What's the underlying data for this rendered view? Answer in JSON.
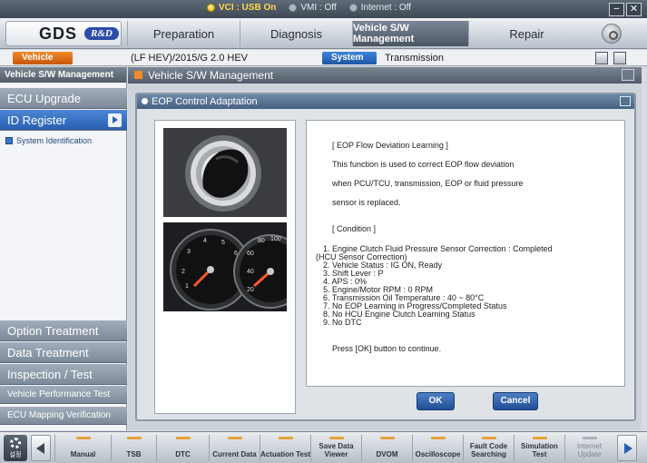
{
  "status": {
    "vci": "VCI : USB On",
    "vmi": "VMI : Off",
    "internet": "Internet : Off",
    "minimize": "−",
    "close": "✕"
  },
  "brand": {
    "logo": "GDS",
    "badge": "R&D"
  },
  "tabs": [
    {
      "label": "Preparation"
    },
    {
      "label": "Diagnosis"
    },
    {
      "label": "Vehicle S/W Management",
      "active": true
    },
    {
      "label": "Repair"
    }
  ],
  "vehicle": {
    "button": "Vehicle",
    "value": "(LF HEV)/2015/G 2.0 HEV",
    "system_button": "System",
    "system_value": "Transmission"
  },
  "sidebar": {
    "header": "Vehicle S/W Management",
    "top_items": [
      {
        "label": "ECU Upgrade"
      },
      {
        "label": "ID Register"
      }
    ],
    "sub_item": "System Identification",
    "bottom_items": [
      {
        "label": "Option Treatment"
      },
      {
        "label": "Data Treatment"
      },
      {
        "label": "Inspection / Test"
      },
      {
        "label": "Vehicle Performance Test"
      },
      {
        "label": "ECU Mapping Verification"
      }
    ]
  },
  "main": {
    "header": "Vehicle S/W Management",
    "dialog_title": "EOP Control Adaptation",
    "lines": [
      "[ EOP Flow Deviation Learning ]",
      "This function is used to correct EOP flow deviation",
      "when PCU/TCU, transmission, EOP or fluid pressure",
      "sensor is replaced.",
      "[ Condition ]",
      "1. Engine Clutch Fluid Pressure Sensor Correction : Completed",
      "(HCU Sensor Correction)",
      "2. Vehicle Status : IG ON, Ready",
      "3. Shift Lever : P",
      "4. APS : 0%",
      "5. Engine/Motor RPM : 0 RPM",
      "6. Transmission Oil Temperature : 40 ~ 80°C",
      "7. No EOP Learning in Progress/Completed Status",
      "8. No HCU Engine Clutch Learning Status",
      "9. No DTC",
      "Press [OK] button to continue."
    ],
    "ok": "OK",
    "cancel": "Cancel"
  },
  "toolbar": {
    "settings": "설정",
    "buttons": [
      {
        "label": "Manual"
      },
      {
        "label": "TSB"
      },
      {
        "label": "DTC"
      },
      {
        "label": "Current Data"
      },
      {
        "label": "Actuation Test"
      },
      {
        "label": "Save Data Viewer"
      },
      {
        "label": "DVOM"
      },
      {
        "label": "Oscilloscope"
      },
      {
        "label": "Fault Code Searching"
      },
      {
        "label": "Simulation Test"
      },
      {
        "label": "Internet Update"
      }
    ]
  }
}
